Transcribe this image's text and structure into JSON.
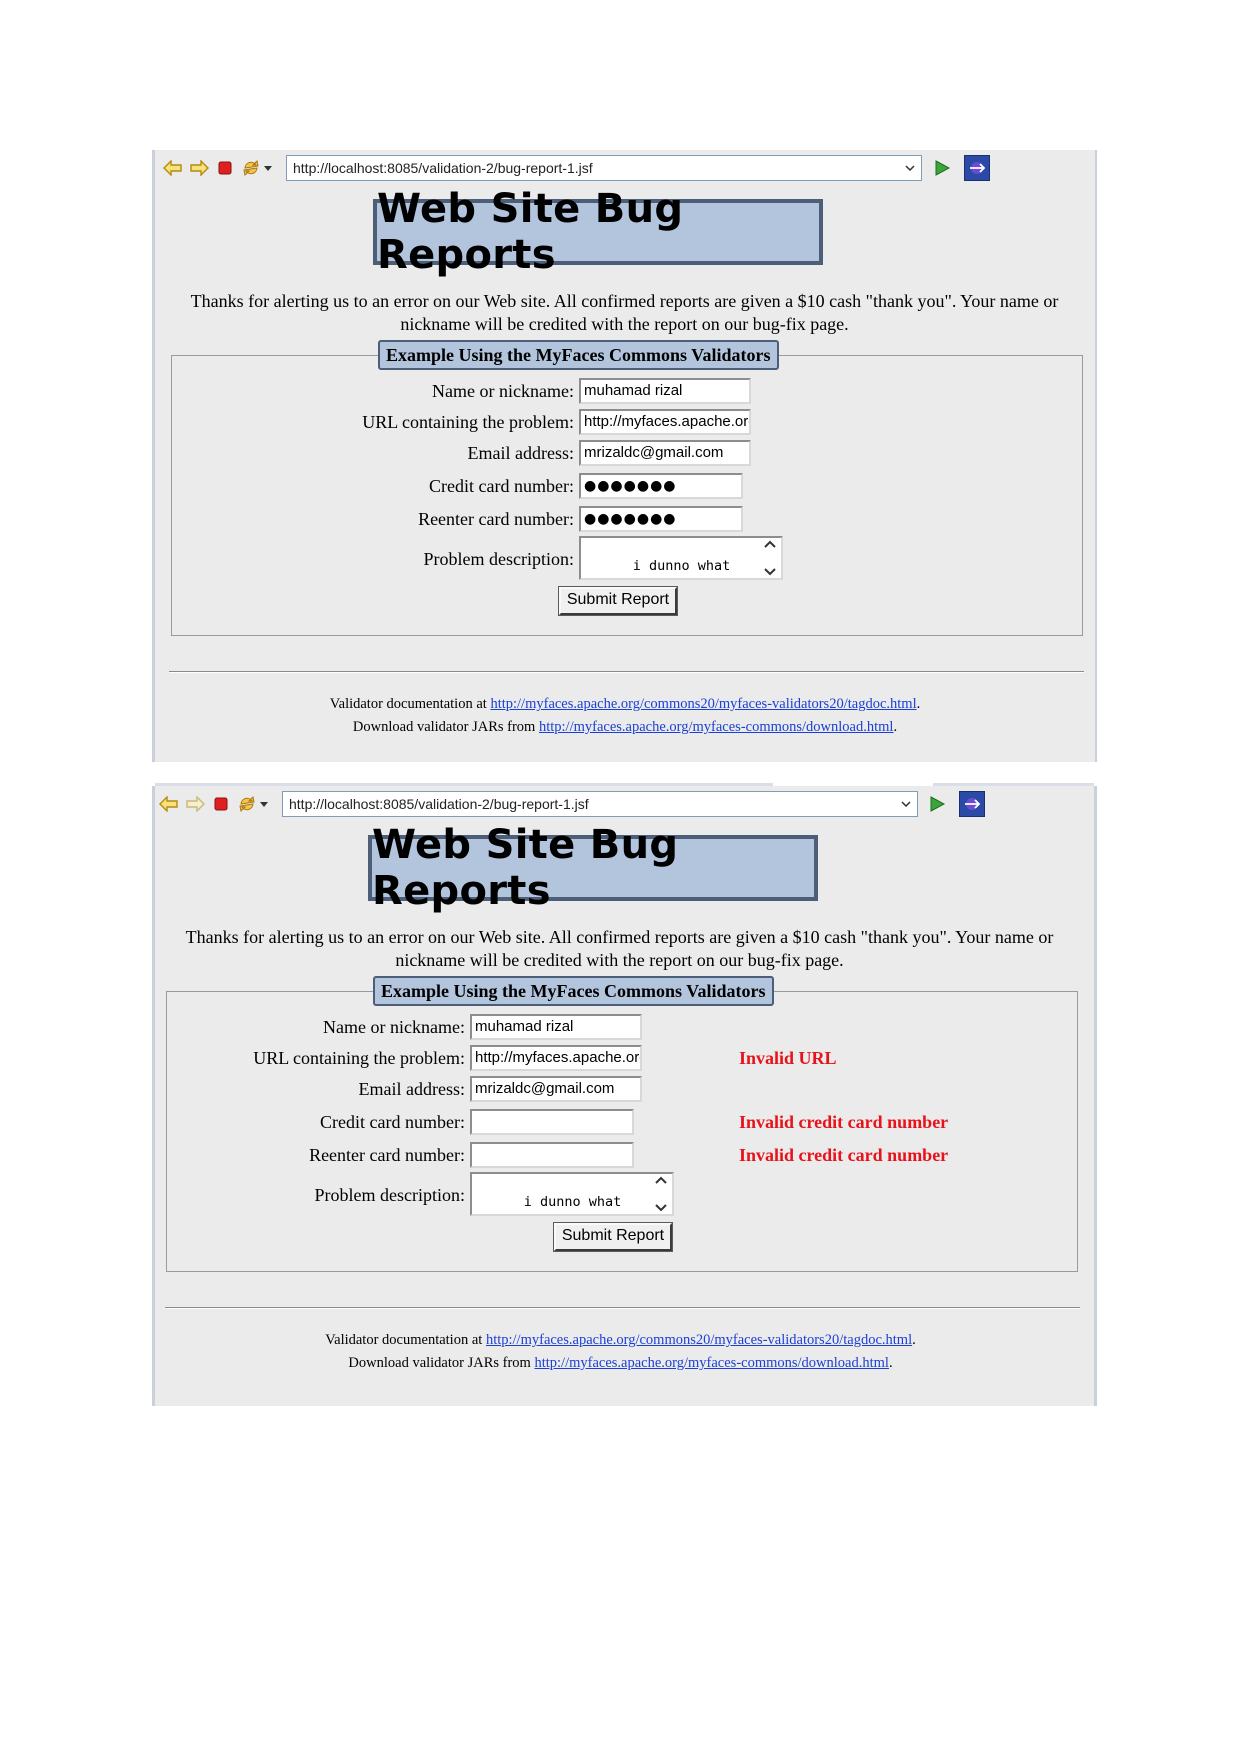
{
  "shot1": {
    "url": "http://localhost:8085/validation-2/bug-report-1.jsf",
    "title": "Web Site Bug Reports",
    "intro": "Thanks for alerting us to an error on our Web site. All confirmed reports are given a $10 cash \"thank you\". Your name or nickname will be credited with the report on our bug-fix page.",
    "legend": "Example Using the MyFaces Commons Validators",
    "fields": {
      "name_label": "Name or nickname:",
      "name_value": "muhamad rizal",
      "url_label": "URL containing the problem:",
      "url_value": "http://myfaces.apache.org",
      "email_label": "Email address:",
      "email_value": "mrizaldc@gmail.com",
      "cc_label": "Credit card number:",
      "cc_value": "●●●●●●●",
      "cc2_label": "Reenter card number:",
      "cc2_value": "●●●●●●●",
      "desc_label": "Problem description:",
      "desc_value": "i dunno what is the\nproblen"
    },
    "submit_label": "Submit Report",
    "footer": {
      "doc_prefix": "Validator documentation at ",
      "doc_link": "http://myfaces.apache.org/commons20/myfaces-validators20/tagdoc.html",
      "doc_suffix": ".",
      "jar_prefix": "Download validator JARs from ",
      "jar_link": "http://myfaces.apache.org/myfaces-commons/download.html",
      "jar_suffix": "."
    }
  },
  "shot2": {
    "url": "http://localhost:8085/validation-2/bug-report-1.jsf",
    "title": "Web Site Bug Reports",
    "intro": "Thanks for alerting us to an error on our Web site. All confirmed reports are given a $10 cash \"thank you\". Your name or nickname will be credited with the report on our bug-fix page.",
    "legend": "Example Using the MyFaces Commons Validators",
    "fields": {
      "name_label": "Name or nickname:",
      "name_value": "muhamad rizal",
      "url_label": "URL containing the problem:",
      "url_value": "http://myfaces.apache.org",
      "url_error": "Invalid URL",
      "email_label": "Email address:",
      "email_value": "mrizaldc@gmail.com",
      "cc_label": "Credit card number:",
      "cc_value": "",
      "cc_error": "Invalid credit card number",
      "cc2_label": "Reenter card number:",
      "cc2_value": "",
      "cc2_error": "Invalid credit card number",
      "desc_label": "Problem description:",
      "desc_value": "i dunno what is the\nproblen"
    },
    "submit_label": "Submit Report",
    "footer": {
      "doc_prefix": "Validator documentation at ",
      "doc_link": "http://myfaces.apache.org/commons20/myfaces-validators20/tagdoc.html",
      "doc_suffix": ".",
      "jar_prefix": "Download validator JARs from ",
      "jar_link": "http://myfaces.apache.org/myfaces-commons/download.html",
      "jar_suffix": "."
    }
  },
  "colors": {
    "error": "#e8121a",
    "title_bg": "#b3c5dd",
    "title_border": "#4d5e78",
    "page_bg": "#ebebeb",
    "link": "#1a3fd6"
  },
  "icons": [
    "back-arrow-icon",
    "forward-arrow-icon",
    "stop-icon",
    "refresh-icon",
    "dropdown-arrow-icon",
    "go-icon",
    "external-browser-icon",
    "scroll-up-icon",
    "scroll-down-icon"
  ]
}
